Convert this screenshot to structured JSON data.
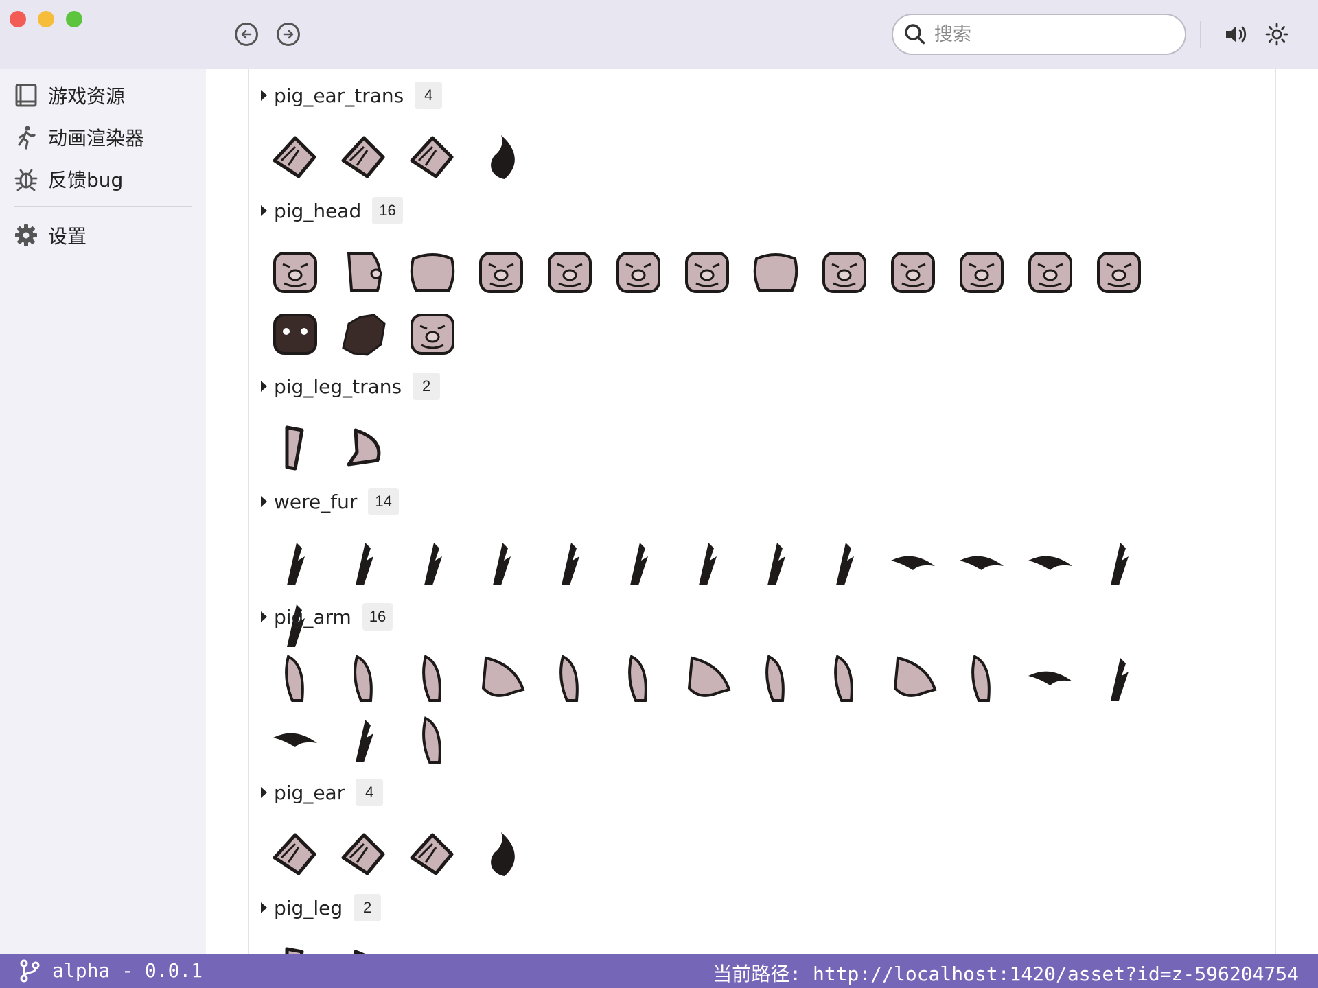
{
  "titlebar": {
    "search_placeholder": "搜索",
    "icons": [
      "back-icon",
      "forward-icon",
      "search-icon",
      "volume-icon",
      "theme-sun-icon"
    ]
  },
  "sidebar": {
    "items": [
      {
        "icon": "book-icon",
        "label": "游戏资源"
      },
      {
        "icon": "running-person-icon",
        "label": "动画渲染器"
      },
      {
        "icon": "bug-icon",
        "label": "反馈bug"
      },
      {
        "icon": "gear-icon",
        "label": "设置"
      }
    ]
  },
  "groups": [
    {
      "name": "pig_ear_trans",
      "count": "4"
    },
    {
      "name": "pig_head",
      "count": "16"
    },
    {
      "name": "pig_leg_trans",
      "count": "2"
    },
    {
      "name": "were_fur",
      "count": "14"
    },
    {
      "name": "pig_arm",
      "count": "16"
    },
    {
      "name": "pig_ear",
      "count": "4"
    },
    {
      "name": "pig_leg",
      "count": "2"
    }
  ],
  "status": {
    "branch_icon": "git-branch-icon",
    "version": "alpha - 0.0.1",
    "path": "当前路径: http://localhost:1420/asset?id=z-596204754"
  },
  "colors": {
    "statusbar": "#7566b8",
    "skin": "#c9b3b6",
    "ink": "#1e1a1a"
  }
}
